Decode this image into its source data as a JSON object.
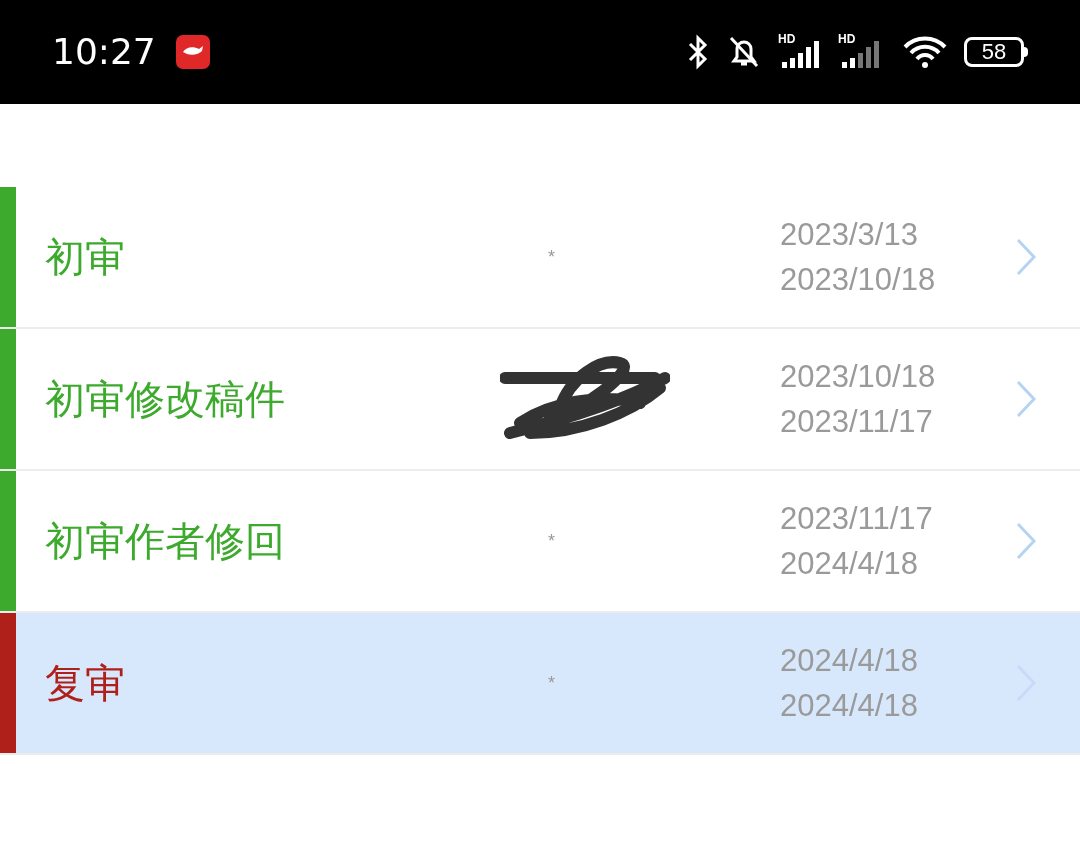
{
  "status_bar": {
    "time": "10:27",
    "signals": [
      "HD",
      "HD"
    ],
    "battery": "58"
  },
  "rows": [
    {
      "title": "初审",
      "kind": "marker",
      "marker": "*",
      "start": "2023/3/13",
      "end": "2023/10/18",
      "color": "#3daa2e",
      "selected": false
    },
    {
      "title": "初审修改稿件",
      "kind": "redacted",
      "start": "2023/10/18",
      "end": "2023/11/17",
      "color": "#3daa2e",
      "selected": false
    },
    {
      "title": "初审作者修回",
      "kind": "marker",
      "marker": "*",
      "start": "2023/11/17",
      "end": "2024/4/18",
      "color": "#3daa2e",
      "selected": false
    },
    {
      "title": "复审",
      "kind": "marker",
      "marker": "*",
      "start": "2024/4/18",
      "end": "2024/4/18",
      "color": "#b0201a",
      "selected": true
    }
  ]
}
